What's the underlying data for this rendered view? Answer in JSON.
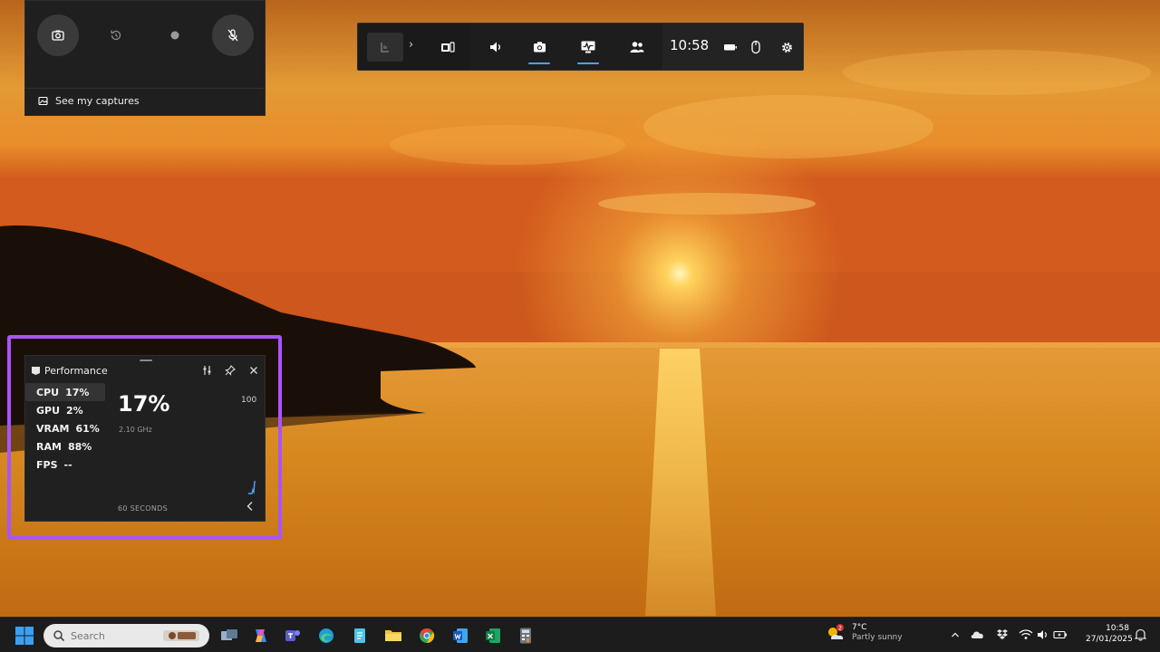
{
  "capture_widget": {
    "buttons": [
      {
        "name": "screenshot",
        "icon": "camera-icon"
      },
      {
        "name": "record-last",
        "icon": "history-icon"
      },
      {
        "name": "start-recording",
        "icon": "record-dot-icon"
      },
      {
        "name": "mic-toggle",
        "icon": "mic-off-icon"
      }
    ],
    "see_captures_label": "See my captures"
  },
  "game_bar": {
    "widgets": [
      "home",
      "widget-store",
      "audio",
      "capture",
      "performance",
      "social"
    ],
    "active_widgets": [
      "capture",
      "performance"
    ],
    "time": "10:58",
    "accent_color": "#4aa3ff"
  },
  "performance": {
    "title": "Performance",
    "metrics": [
      {
        "label": "CPU",
        "value": "17%"
      },
      {
        "label": "GPU",
        "value": "2%"
      },
      {
        "label": "VRAM",
        "value": "61%"
      },
      {
        "label": "RAM",
        "value": "88%"
      },
      {
        "label": "FPS",
        "value": "--"
      }
    ],
    "selected": "CPU",
    "big_value": "17%",
    "frequency": "2.10 GHz",
    "max_value": "100",
    "time_span": "60 SECONDS",
    "highlight_color": "#a855f7"
  },
  "taskbar": {
    "search_placeholder": "Search",
    "apps": [
      "task-view",
      "copilot",
      "teams",
      "edge",
      "notepad",
      "file-explorer",
      "chrome",
      "word",
      "excel",
      "calculator"
    ],
    "weather": {
      "temp": "7°C",
      "desc": "Partly sunny",
      "badge": "2"
    },
    "time": "10:58",
    "date": "27/01/2025"
  }
}
